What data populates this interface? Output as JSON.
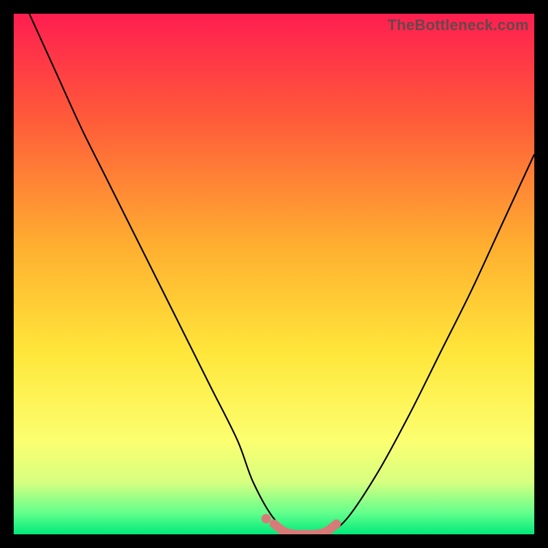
{
  "watermark": "TheBottleneck.com",
  "chart_data": {
    "type": "line",
    "title": "",
    "xlabel": "",
    "ylabel": "",
    "xlim": [
      0,
      100
    ],
    "ylim": [
      0,
      100
    ],
    "background_gradient": {
      "stops": [
        {
          "pos": 0.0,
          "color": "#ff1e50"
        },
        {
          "pos": 0.2,
          "color": "#ff5a3a"
        },
        {
          "pos": 0.45,
          "color": "#ffb030"
        },
        {
          "pos": 0.65,
          "color": "#ffe63a"
        },
        {
          "pos": 0.82,
          "color": "#fcff70"
        },
        {
          "pos": 0.9,
          "color": "#d7ff80"
        },
        {
          "pos": 0.96,
          "color": "#60ff8c"
        },
        {
          "pos": 1.0,
          "color": "#00e97a"
        }
      ]
    },
    "series": [
      {
        "name": "bottleneck-curve",
        "color": "#000000",
        "x": [
          3,
          8,
          13,
          18,
          23,
          28,
          33,
          38,
          43,
          46,
          50,
          54,
          58,
          60,
          64,
          70,
          76,
          82,
          88,
          94,
          100
        ],
        "y": [
          100,
          89,
          78,
          68,
          58,
          48,
          38,
          28,
          18,
          10,
          3,
          0,
          0,
          0,
          3,
          12,
          23,
          35,
          47,
          60,
          73
        ]
      },
      {
        "name": "optimal-band-marker",
        "color": "#d77b78",
        "x": [
          50,
          52,
          54,
          56,
          58,
          60,
          62
        ],
        "y": [
          2,
          0.5,
          0,
          0,
          0,
          0.5,
          2
        ]
      }
    ],
    "optimal_range_x": [
      50,
      62
    ],
    "annotations": []
  }
}
